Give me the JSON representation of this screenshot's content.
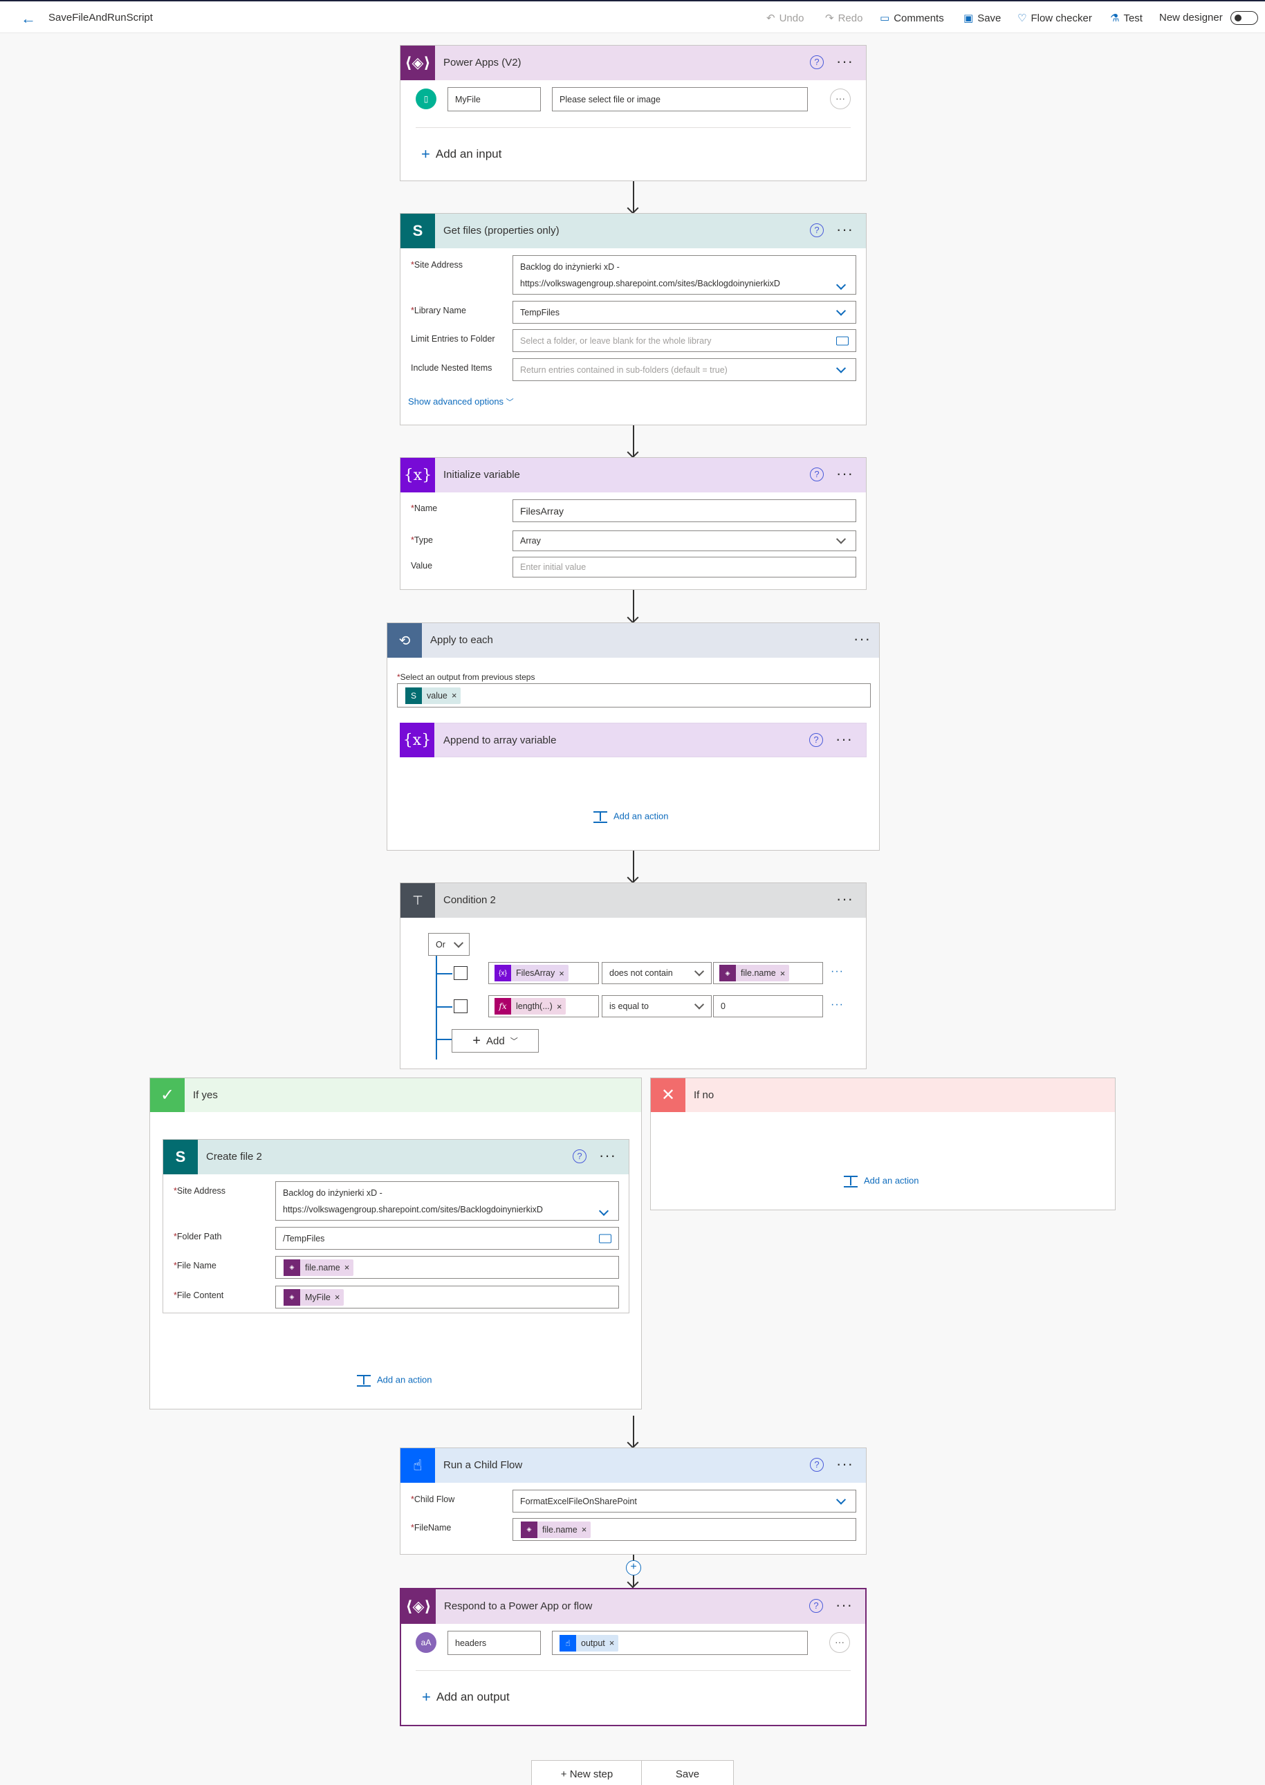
{
  "topbar": {
    "flow_title": "SaveFileAndRunScript",
    "undo": "Undo",
    "redo": "Redo",
    "comments": "Comments",
    "save": "Save",
    "flow_checker": "Flow checker",
    "test": "Test",
    "new_designer": "New designer"
  },
  "powerapps": {
    "title": "Power Apps (V2)",
    "input_name": "MyFile",
    "input_desc": "Please select file or image",
    "add_input": "Add an input"
  },
  "getfiles": {
    "title": "Get files (properties only)",
    "site_label": "Site Address",
    "site_line1": "Backlog do inżynierki xD -",
    "site_line2": "https://volkswagengroup.sharepoint.com/sites/BacklogdoinynierkixD",
    "library_label": "Library Name",
    "library_value": "TempFiles",
    "limit_label": "Limit Entries to Folder",
    "limit_placeholder": "Select a folder, or leave blank for the whole library",
    "nested_label": "Include Nested Items",
    "nested_placeholder": "Return entries contained in sub-folders (default = true)",
    "advanced": "Show advanced options"
  },
  "initvar": {
    "title": "Initialize variable",
    "name_label": "Name",
    "name_value": "FilesArray",
    "type_label": "Type",
    "type_value": "Array",
    "value_label": "Value",
    "value_placeholder": "Enter initial value"
  },
  "applyeach": {
    "title": "Apply to each",
    "select_label": "Select an output from previous steps",
    "token": "value",
    "inner_title": "Append to array variable",
    "add_action": "Add an action"
  },
  "condition": {
    "title": "Condition 2",
    "group_op": "Or",
    "rows": [
      {
        "left": "FilesArray",
        "op": "does not contain",
        "right": "file.name"
      },
      {
        "left": "length(...)",
        "op": "is equal to",
        "right": "0"
      }
    ],
    "add": "Add"
  },
  "ifyes": {
    "title": "If yes",
    "create": {
      "title": "Create file 2",
      "site_label": "Site Address",
      "site_line1": "Backlog do inżynierki xD -",
      "site_line2": "https://volkswagengroup.sharepoint.com/sites/BacklogdoinynierkixD",
      "folder_label": "Folder Path",
      "folder_value": "/TempFiles",
      "filename_label": "File Name",
      "filename_token": "file.name",
      "content_label": "File Content",
      "content_token": "MyFile"
    },
    "add_action": "Add an action"
  },
  "ifno": {
    "title": "If no",
    "add_action": "Add an action"
  },
  "childflow": {
    "title": "Run a Child Flow",
    "child_label": "Child Flow",
    "child_value": "FormatExcelFileOnSharePoint",
    "filename_label": "FileName",
    "filename_token": "file.name"
  },
  "respond": {
    "title": "Respond to a Power App or flow",
    "avatar": "aA",
    "output_name": "headers",
    "output_token": "output",
    "add_output": "Add an output"
  },
  "footer": {
    "new_step": "+ New step",
    "save": "Save"
  },
  "colors": {
    "powerapps": "#742774",
    "sharepoint": "#036c70",
    "variable": "#770bd6",
    "loop": "#486991",
    "condition": "#484f58",
    "childflow": "#0066ff",
    "yes": "#4bbe5c",
    "no": "#f26c6c"
  },
  "icons": {
    "back": "arrow-left-icon",
    "undo": "undo-icon",
    "redo": "redo-icon",
    "comments": "comment-icon",
    "save": "save-icon",
    "flow_checker": "stethoscope-icon",
    "test": "flask-icon"
  }
}
